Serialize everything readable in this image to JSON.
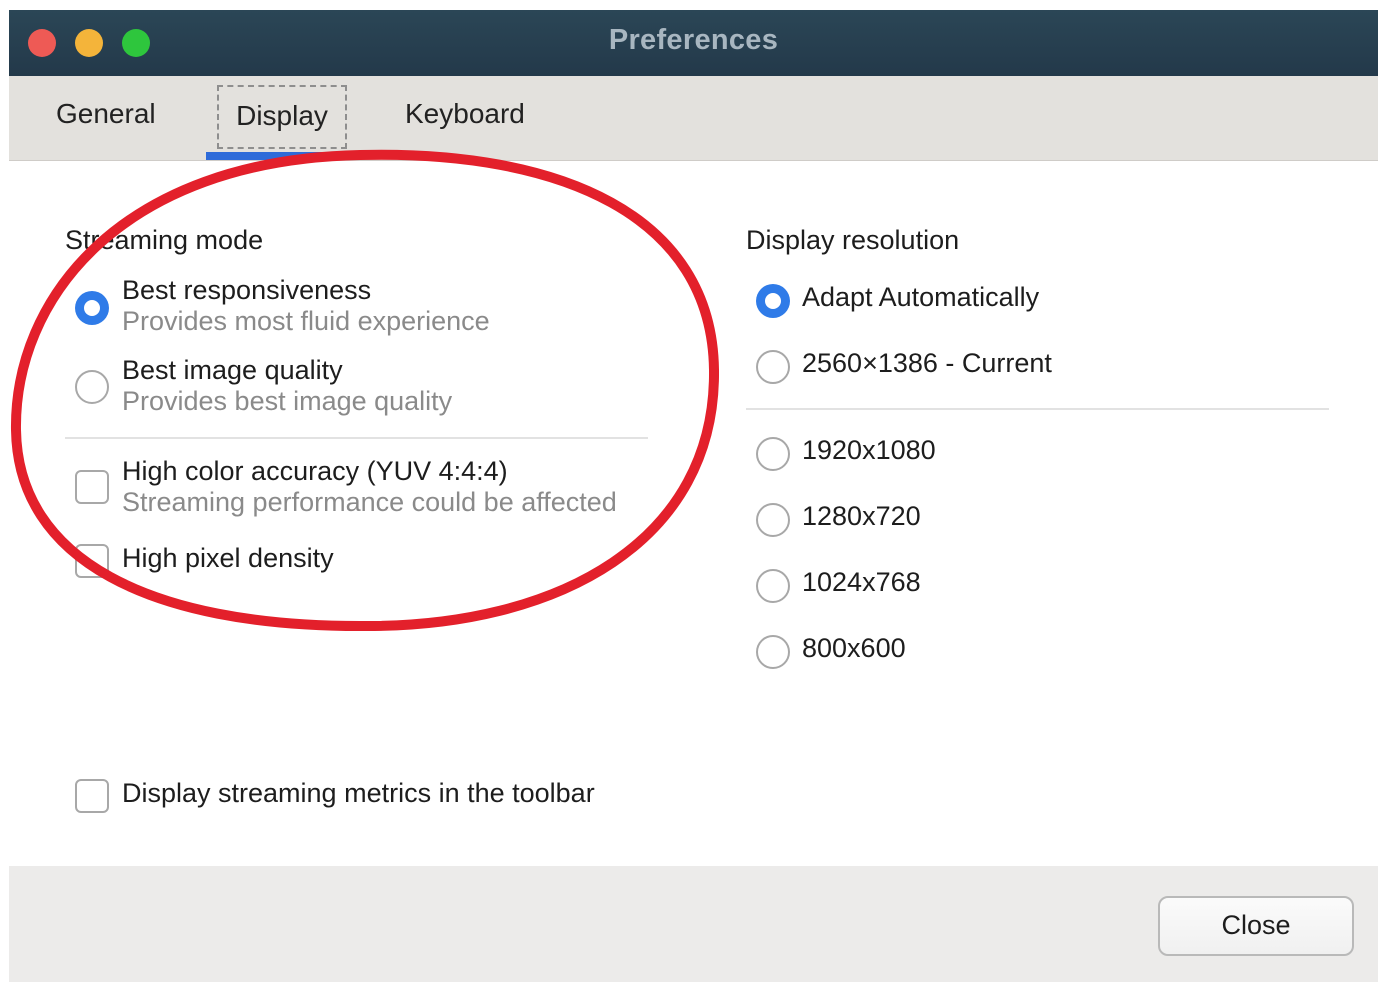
{
  "window": {
    "title": "Preferences"
  },
  "tabs": [
    {
      "label": "General"
    },
    {
      "label": "Display"
    },
    {
      "label": "Keyboard"
    }
  ],
  "streaming": {
    "section_label": "Streaming mode",
    "options": [
      {
        "label": "Best responsiveness",
        "sub": "Provides most fluid experience",
        "selected": true
      },
      {
        "label": "Best image quality",
        "sub": "Provides best image quality",
        "selected": false
      }
    ],
    "checks": [
      {
        "label": "High color accuracy (YUV 4:4:4)",
        "sub": "Streaming performance could be affected",
        "checked": false
      },
      {
        "label": "High pixel density",
        "checked": false
      }
    ]
  },
  "resolution": {
    "section_label": "Display resolution",
    "options": [
      {
        "label": "Adapt Automatically",
        "selected": true
      },
      {
        "label": "2560×1386 - Current",
        "selected": false
      },
      {
        "label": "1920x1080",
        "selected": false
      },
      {
        "label": "1280x720",
        "selected": false
      },
      {
        "label": "1024x768",
        "selected": false
      },
      {
        "label": "800x600",
        "selected": false
      }
    ]
  },
  "metrics": {
    "label": "Display streaming metrics in the toolbar",
    "checked": false
  },
  "footer": {
    "close_label": "Close"
  },
  "colors": {
    "accent": "#2f7be8",
    "annotation": "#e3202b",
    "titlebar": "#24394a"
  }
}
